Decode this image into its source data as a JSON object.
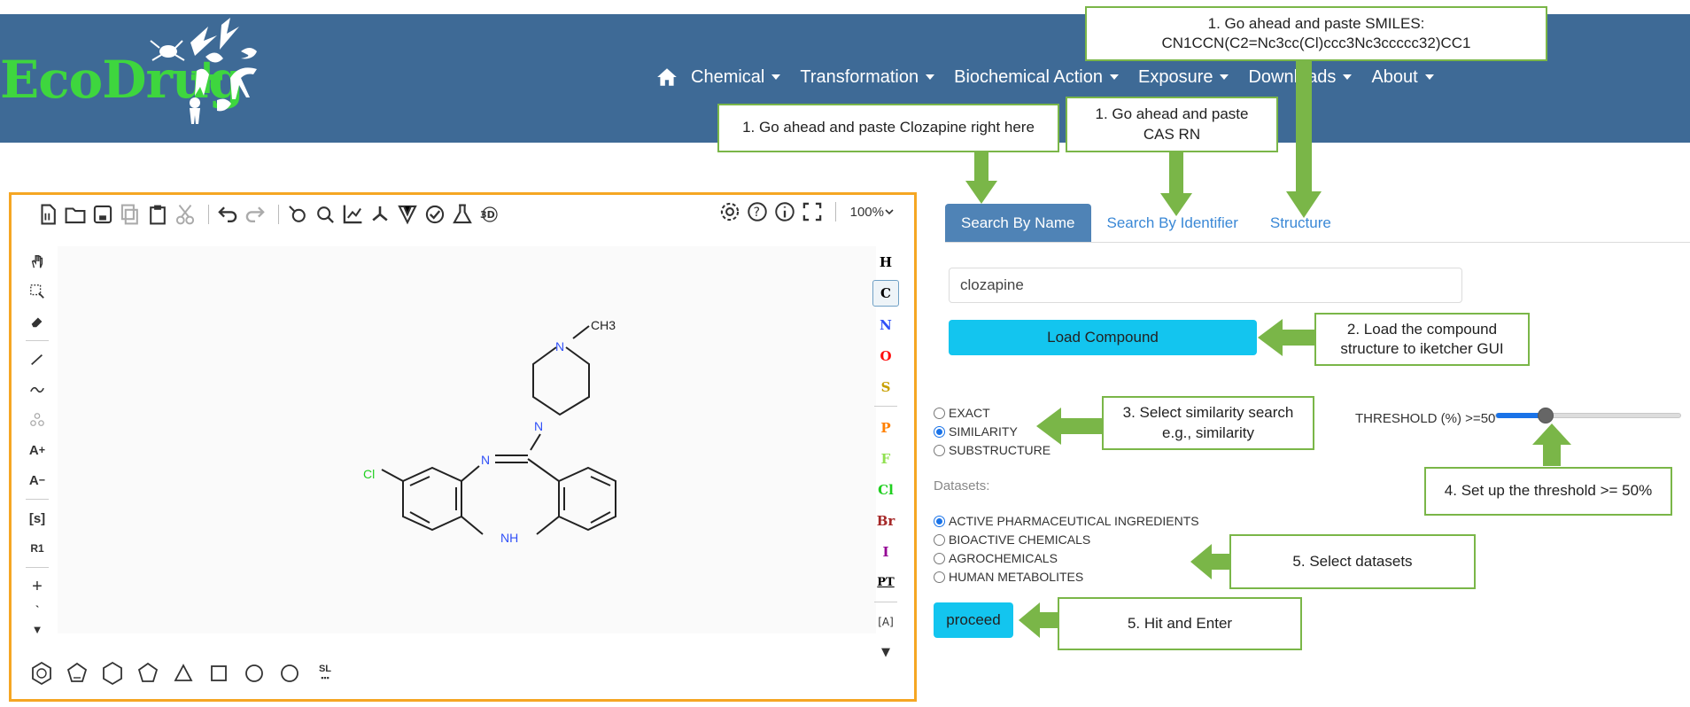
{
  "header": {
    "logo_text": "EcoDrug",
    "logo_plus": "+",
    "nav": [
      {
        "label": "Chemical"
      },
      {
        "label": "Transformation"
      },
      {
        "label": "Biochemical Action"
      },
      {
        "label": "Exposure"
      },
      {
        "label": "Downloads"
      },
      {
        "label": "About"
      }
    ],
    "icons": {
      "home": "home-icon"
    }
  },
  "colors": {
    "header_bg": "#3e6a96",
    "logo_green": "#3ed63e",
    "callout_green": "#7ab648",
    "ketcher_border": "#f5a623",
    "button_cyan": "#13c5ef",
    "tab_active": "#4f83b6"
  },
  "callouts": {
    "smiles_line1": "1. Go ahead and paste SMILES:",
    "smiles_line2": "CN1CCN(C2=Nc3cc(Cl)ccc3Nc3ccccc32)CC1",
    "name": "1. Go ahead and paste Clozapine right here",
    "cas_line1": "1. Go ahead and paste",
    "cas_line2": "CAS RN",
    "load_line1": "2. Load the compound",
    "load_line2": "structure to iketcher GUI",
    "similarity_line1": "3. Select similarity search",
    "similarity_line2": "e.g., similarity",
    "threshold": "4. Set up the threshold >= 50%",
    "datasets": "5. Select datasets",
    "proceed": "5. Hit and Enter"
  },
  "ketcher": {
    "zoom": "100%",
    "left_tools": [
      "hand-icon",
      "select-icon",
      "eraser-icon",
      "bond-icon",
      "chain-icon",
      "sgroup-icon",
      "charge-plus-icon",
      "charge-minus-icon",
      "s-group-bracket-icon",
      "rgroup-icon",
      "plus-icon",
      "arrow-icon",
      "expand-icon"
    ],
    "left_labels": {
      "s": "[s]",
      "r1": "R1",
      "aplus": "A",
      "aminus": "A"
    },
    "atoms": [
      {
        "symbol": "H",
        "color": "#000000"
      },
      {
        "symbol": "C",
        "color": "#000000"
      },
      {
        "symbol": "N",
        "color": "#3050f8"
      },
      {
        "symbol": "O",
        "color": "#ff0d0d"
      },
      {
        "symbol": "S",
        "color": "#c8a000"
      },
      {
        "symbol": "P",
        "color": "#ff8000"
      },
      {
        "symbol": "F",
        "color": "#90e050"
      },
      {
        "symbol": "Cl",
        "color": "#1ff01f"
      },
      {
        "symbol": "Br",
        "color": "#a62929"
      },
      {
        "symbol": "I",
        "color": "#940094"
      },
      {
        "symbol": "PT",
        "color": "#000000"
      }
    ],
    "molecule_labels": {
      "methyl": "CH3",
      "n_top": "N",
      "n_bottom": "N",
      "n_ring": "N",
      "nh": "NH",
      "cl": "Cl"
    },
    "bottom_shapes": [
      "benzene-icon",
      "cyclopentadiene-icon",
      "cyclohexane-icon",
      "cyclopentane-icon",
      "cyclopropane-icon",
      "cyclobutane-icon",
      "cycloheptane-icon",
      "cyclooctane-icon",
      "sl-template-icon"
    ],
    "bottom_sl": "SL"
  },
  "search": {
    "tabs": [
      {
        "label": "Search By Name",
        "active": true
      },
      {
        "label": "Search By Identifier",
        "active": false
      },
      {
        "label": "Structure",
        "active": false
      }
    ],
    "name_value": "clozapine",
    "load_button": "Load Compound",
    "modes": [
      {
        "label": "EXACT",
        "checked": false
      },
      {
        "label": "SIMILARITY",
        "checked": true
      },
      {
        "label": "SUBSTRUCTURE",
        "checked": false
      }
    ],
    "threshold_label": "THRESHOLD (%) >=50",
    "threshold_value": 50,
    "datasets_label": "Datasets:",
    "datasets": [
      {
        "label": "ACTIVE PHARMACEUTICAL INGREDIENTS",
        "checked": true
      },
      {
        "label": "BIOACTIVE CHEMICALS",
        "checked": false
      },
      {
        "label": "AGROCHEMICALS",
        "checked": false
      },
      {
        "label": "HUMAN METABOLITES",
        "checked": false
      }
    ],
    "proceed_button": "proceed"
  }
}
